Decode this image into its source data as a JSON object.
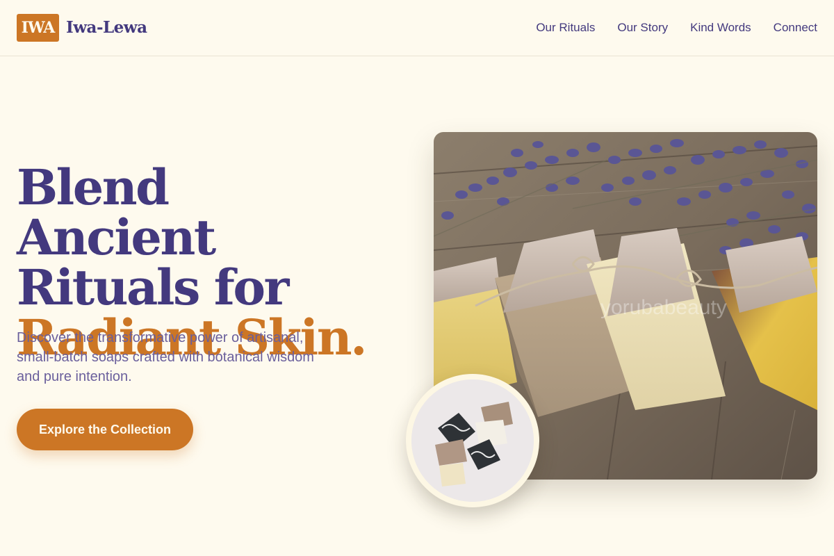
{
  "header": {
    "logo_text": "IWA",
    "brand": "Iwa-Lewa",
    "nav": [
      "Our Rituals",
      "Our Story",
      "Kind Words",
      "Connect"
    ]
  },
  "hero": {
    "headline_line1": "Blend Ancient",
    "headline_line2": "Rituals for",
    "headline_accent": "Radiant Skin.",
    "subtext": "Discover the transformative power of artisanal, small-batch soaps crafted with botanical wisdom and pure intention.",
    "cta_label": "Explore the Collection",
    "main_image_alt": "Handmade soap bars tied with twine beside lavender",
    "thumb_image_alt": "Assorted handmade soap pieces",
    "watermark": "yorubabeauty"
  },
  "colors": {
    "background": "#fefaee",
    "primary": "#43397e",
    "accent": "#cc7625",
    "muted": "#6a5f9c"
  }
}
